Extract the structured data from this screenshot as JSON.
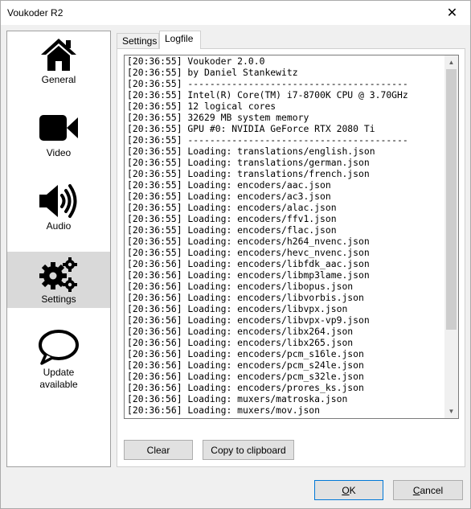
{
  "window": {
    "title": "Voukoder R2",
    "close_glyph": "✕"
  },
  "sidebar": {
    "items": [
      {
        "label": "General",
        "icon": "home-icon",
        "selected": false
      },
      {
        "label": "Video",
        "icon": "video-camera-icon",
        "selected": false
      },
      {
        "label": "Audio",
        "icon": "speaker-icon",
        "selected": false
      },
      {
        "label": "Settings",
        "icon": "gears-icon",
        "selected": true
      },
      {
        "label_line1": "Update",
        "label_line2": "available",
        "icon": "speech-bubble-icon",
        "selected": false
      }
    ]
  },
  "tabs": [
    {
      "label": "Settings",
      "active": false
    },
    {
      "label": "Logfile",
      "active": true
    }
  ],
  "log": {
    "lines": [
      "[20:36:55] Voukoder 2.0.0",
      "[20:36:55] by Daniel Stankewitz",
      "[20:36:55] ----------------------------------------",
      "[20:36:55] Intel(R) Core(TM) i7-8700K CPU @ 3.70GHz",
      "[20:36:55] 12 logical cores",
      "[20:36:55] 32629 MB system memory",
      "[20:36:55] GPU #0: NVIDIA GeForce RTX 2080 Ti",
      "[20:36:55] ----------------------------------------",
      "[20:36:55] Loading: translations/english.json",
      "[20:36:55] Loading: translations/german.json",
      "[20:36:55] Loading: translations/french.json",
      "[20:36:55] Loading: encoders/aac.json",
      "[20:36:55] Loading: encoders/ac3.json",
      "[20:36:55] Loading: encoders/alac.json",
      "[20:36:55] Loading: encoders/ffv1.json",
      "[20:36:55] Loading: encoders/flac.json",
      "[20:36:55] Loading: encoders/h264_nvenc.json",
      "[20:36:55] Loading: encoders/hevc_nvenc.json",
      "[20:36:56] Loading: encoders/libfdk_aac.json",
      "[20:36:56] Loading: encoders/libmp3lame.json",
      "[20:36:56] Loading: encoders/libopus.json",
      "[20:36:56] Loading: encoders/libvorbis.json",
      "[20:36:56] Loading: encoders/libvpx.json",
      "[20:36:56] Loading: encoders/libvpx-vp9.json",
      "[20:36:56] Loading: encoders/libx264.json",
      "[20:36:56] Loading: encoders/libx265.json",
      "[20:36:56] Loading: encoders/pcm_s16le.json",
      "[20:36:56] Loading: encoders/pcm_s24le.json",
      "[20:36:56] Loading: encoders/pcm_s32le.json",
      "[20:36:56] Loading: encoders/prores_ks.json",
      "[20:36:56] Loading: muxers/matroska.json",
      "[20:36:56] Loading: muxers/mov.json"
    ]
  },
  "buttons": {
    "clear": "Clear",
    "copy": "Copy to clipboard",
    "ok": "OK",
    "cancel": "Cancel"
  }
}
